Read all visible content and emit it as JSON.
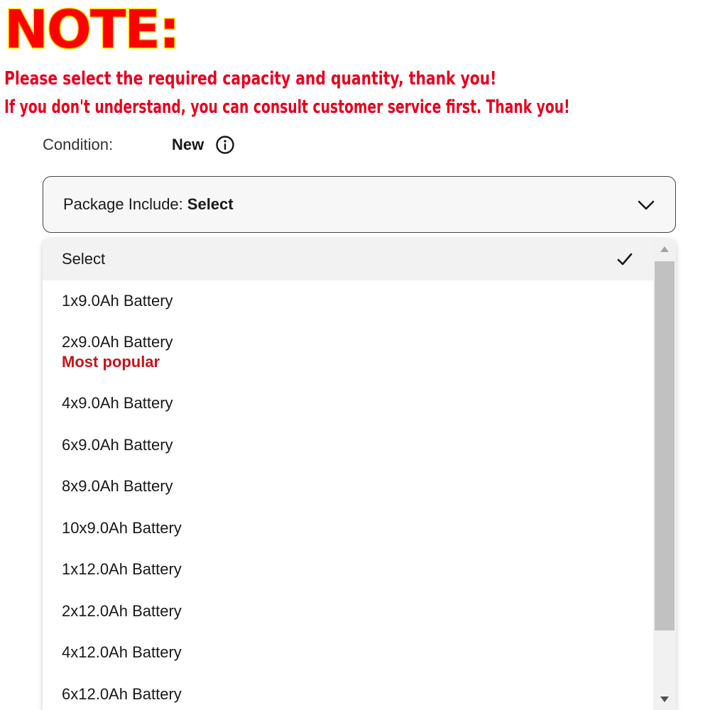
{
  "note": {
    "title": "NOTE:",
    "line1": "Please select the required capacity and quantity, thank you!",
    "line2": "If you don't understand, you can consult customer service first. Thank you!"
  },
  "condition": {
    "label": "Condition:",
    "value": "New"
  },
  "package_select": {
    "label": "Package Include:",
    "value": "Select"
  },
  "dropdown": {
    "options": [
      {
        "label": "Select",
        "selected": true
      },
      {
        "label": "1x9.0Ah Battery"
      },
      {
        "label": "2x9.0Ah Battery",
        "badge": "Most popular"
      },
      {
        "label": "4x9.0Ah Battery"
      },
      {
        "label": "6x9.0Ah Battery"
      },
      {
        "label": "8x9.0Ah Battery"
      },
      {
        "label": "10x9.0Ah Battery"
      },
      {
        "label": "1x12.0Ah Battery"
      },
      {
        "label": "2x12.0Ah Battery"
      },
      {
        "label": "4x12.0Ah Battery"
      },
      {
        "label": "6x12.0Ah Battery"
      }
    ]
  },
  "colors": {
    "note_red": "#ff0000",
    "note_outline": "#ffe000",
    "badge_red": "#c7141a"
  },
  "icons": {
    "info": "info-circle-icon",
    "chevron": "chevron-down-icon",
    "check": "checkmark-icon"
  }
}
